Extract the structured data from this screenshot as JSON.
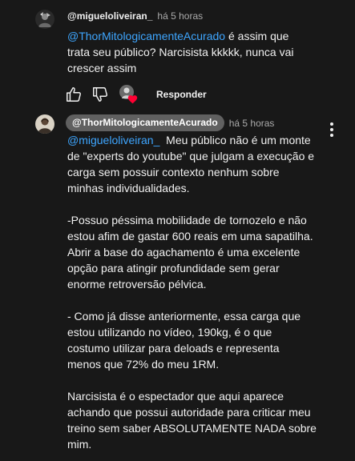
{
  "comment1": {
    "author": "@migueloliveiran_",
    "time": "há 5 horas",
    "mention": "@ThorMitologicamenteAcurado",
    "text_line1_rest": " é assim que",
    "text_rest": "trata seu público? Narcisista kkkkk, nunca vai\ncrescer assim",
    "reply_label": "Responder",
    "like_icon": "thumbs-up-outline",
    "dislike_icon": "thumbs-down-outline",
    "heart_icon": "creator-heart"
  },
  "comment2": {
    "author": "@ThorMitologicamenteAcurado",
    "time": "há 5 horas",
    "mention": "@migueloliveiran_",
    "text_line1_rest": "  Meu público não é um monte",
    "text_rest": "de \"experts do youtube\" que julgam a execução e\ncarga sem possuir contexto nenhum sobre\nminhas individualidades.\n\n-Possuo péssima mobilidade de tornozelo e não\nestou afim de gastar 600 reais em uma sapatilha.\nAbrir a base do agachamento é uma excelente\nopção para atingir profundidade sem gerar\nenorme retroversão pélvica.\n\n- Como já disse anteriormente, essa carga que\nestou utilizando no vídeo, 190kg, é o que\ncostumo utilizar para deloads e representa\nmenos que 72% do meu 1RM.\n\nNarcisista é o espectador que aqui aparece\nachando que possui autoridade para criticar meu\ntreino sem saber ABSOLUTAMENTE NADA sobre\nmim.",
    "more_icon": "vertical-dots"
  },
  "colors": {
    "background": "#181818",
    "text": "#f1f1f1",
    "secondary": "#aaaaaa",
    "link": "#3ea6ff",
    "badge": "#606060",
    "heart": "#ff0033"
  }
}
